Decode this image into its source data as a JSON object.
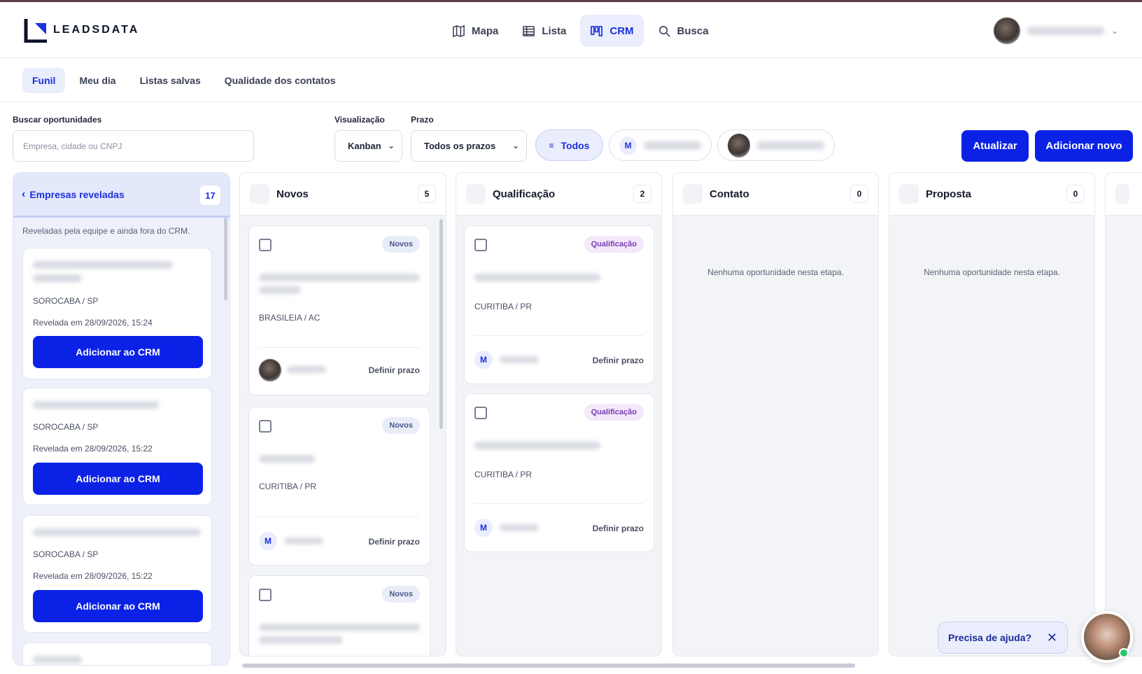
{
  "colors": {
    "primary": "#0b22e6",
    "accent_bg": "#eaedfb",
    "tag_qual": "#7a3bb5",
    "online": "#2cc36b"
  },
  "brand": {
    "name": "LEADSDATA"
  },
  "nav": {
    "items": [
      {
        "label": "Mapa",
        "icon": "map-icon"
      },
      {
        "label": "Lista",
        "icon": "table-icon"
      },
      {
        "label": "CRM",
        "icon": "kanban-icon"
      },
      {
        "label": "Busca",
        "icon": "search-icon"
      }
    ]
  },
  "subnav": {
    "tabs": [
      "Funil",
      "Meu dia",
      "Listas salvas",
      "Qualidade dos contatos"
    ]
  },
  "filters": {
    "search_label": "Buscar oportunidades",
    "search_placeholder": "Empresa, cidade ou CNPJ",
    "view_label": "Visualização",
    "view_value": "Kanban",
    "deadline_label": "Prazo",
    "deadline_value": "Todos os prazos",
    "owner_all": "Todos",
    "owner_m_initial": "M"
  },
  "actions": {
    "refresh": "Atualizar",
    "add_new": "Adicionar novo"
  },
  "revealed": {
    "title": "Empresas reveladas",
    "count": "17",
    "description": "Reveladas pela equipe e ainda fora do CRM.",
    "add_label": "Adicionar ao CRM",
    "cards": [
      {
        "city": "SOROCABA / SP",
        "revealed_at": "Revelada em 28/09/2026, 15:24"
      },
      {
        "city": "SOROCABA / SP",
        "revealed_at": "Revelada em 28/09/2026, 15:22"
      },
      {
        "city": "SOROCABA / SP",
        "revealed_at": "Revelada em 28/09/2026, 15:22"
      }
    ]
  },
  "columns": [
    {
      "title": "Novos",
      "count": "5"
    },
    {
      "title": "Qualificação",
      "count": "2"
    },
    {
      "title": "Contato",
      "count": "0",
      "empty": "Nenhuma oportunidade nesta etapa."
    },
    {
      "title": "Proposta",
      "count": "0",
      "empty": "Nenhuma oportunidade nesta etapa."
    }
  ],
  "cards": {
    "deadline_label": "Definir prazo",
    "initial": "M",
    "novos": [
      {
        "tag": "Novos",
        "city": "BRASILEIA / AC"
      },
      {
        "tag": "Novos",
        "city": "CURITIBA / PR"
      },
      {
        "tag": "Novos"
      }
    ],
    "qualificacao": [
      {
        "tag": "Qualificação",
        "city": "CURITIBA / PR"
      },
      {
        "tag": "Qualificação",
        "city": "CURITIBA / PR"
      }
    ]
  },
  "help": {
    "label": "Precisa de ajuda?",
    "close": "✕"
  }
}
